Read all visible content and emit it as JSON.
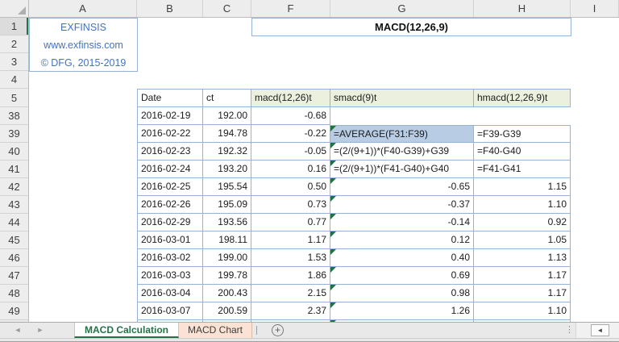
{
  "columns": [
    "A",
    "B",
    "C",
    "F",
    "G",
    "H",
    "I"
  ],
  "brand": {
    "line1": "EXFINSIS",
    "line2": "www.exfinsis.com",
    "line3": "© DFG, 2015-2019"
  },
  "title_cell": "MACD(12,26,9)",
  "table": {
    "headers": {
      "date": "Date",
      "ct": "ct",
      "macd": "macd(12,26)t",
      "smacd": "smacd(9)t",
      "hmacd": "hmacd(12,26,9)t"
    },
    "rows": [
      {
        "n": "38",
        "date": "2016-02-19",
        "ct": "192.00",
        "macd": "-0.68",
        "smacd": null,
        "hmacd": null,
        "flag": false,
        "highlight": false
      },
      {
        "n": "39",
        "date": "2016-02-22",
        "ct": "194.78",
        "macd": "-0.22",
        "smacd": "=AVERAGE(F31:F39)",
        "hmacd": "=F39-G39",
        "flag": true,
        "highlight": true
      },
      {
        "n": "40",
        "date": "2016-02-23",
        "ct": "192.32",
        "macd": "-0.05",
        "smacd": "=(2/(9+1))*(F40-G39)+G39",
        "hmacd": "=F40-G40",
        "flag": true,
        "highlight": false
      },
      {
        "n": "41",
        "date": "2016-02-24",
        "ct": "193.20",
        "macd": "0.16",
        "smacd": "=(2/(9+1))*(F41-G40)+G40",
        "hmacd": "=F41-G41",
        "flag": true,
        "highlight": false
      },
      {
        "n": "42",
        "date": "2016-02-25",
        "ct": "195.54",
        "macd": "0.50",
        "smacd": "-0.65",
        "hmacd": "1.15",
        "flag": true,
        "highlight": false
      },
      {
        "n": "43",
        "date": "2016-02-26",
        "ct": "195.09",
        "macd": "0.73",
        "smacd": "-0.37",
        "hmacd": "1.10",
        "flag": true,
        "highlight": false
      },
      {
        "n": "44",
        "date": "2016-02-29",
        "ct": "193.56",
        "macd": "0.77",
        "smacd": "-0.14",
        "hmacd": "0.92",
        "flag": true,
        "highlight": false
      },
      {
        "n": "45",
        "date": "2016-03-01",
        "ct": "198.11",
        "macd": "1.17",
        "smacd": "0.12",
        "hmacd": "1.05",
        "flag": true,
        "highlight": false
      },
      {
        "n": "46",
        "date": "2016-03-02",
        "ct": "199.00",
        "macd": "1.53",
        "smacd": "0.40",
        "hmacd": "1.13",
        "flag": true,
        "highlight": false
      },
      {
        "n": "47",
        "date": "2016-03-03",
        "ct": "199.78",
        "macd": "1.86",
        "smacd": "0.69",
        "hmacd": "1.17",
        "flag": true,
        "highlight": false
      },
      {
        "n": "48",
        "date": "2016-03-04",
        "ct": "200.43",
        "macd": "2.15",
        "smacd": "0.98",
        "hmacd": "1.17",
        "flag": true,
        "highlight": false
      },
      {
        "n": "49",
        "date": "2016-03-07",
        "ct": "200.59",
        "macd": "2.37",
        "smacd": "1.26",
        "hmacd": "1.10",
        "flag": true,
        "highlight": false
      }
    ]
  },
  "sheet_tabs": {
    "calculation": "MACD Calculation",
    "chart": "MACD Chart",
    "add": "+"
  },
  "icons": {
    "select_all_corner": "corner-triangle",
    "flag_marker": "green-formula-flag-triangle",
    "prev": "◄",
    "next": "►",
    "dots": "⋮",
    "scroll_left": "◄"
  },
  "colors": {
    "accent_green": "#217346",
    "table_border": "#95B3D7",
    "header_green": "#EBF1DE",
    "highlight_blue": "#B8CCE4",
    "brand_blue": "#4472C4",
    "chart_tab_peach": "#FBE2D5",
    "flag_green": "#1E7145"
  }
}
